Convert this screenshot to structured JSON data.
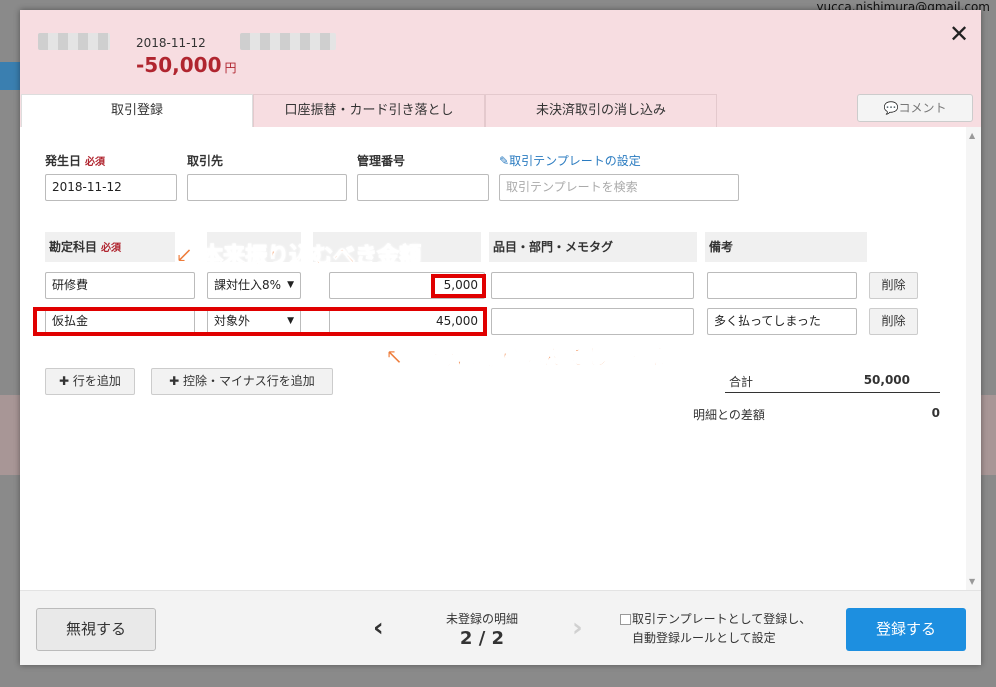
{
  "background": {
    "email": "yucca.nishimura@gmail.com"
  },
  "header": {
    "date": "2018-11-12",
    "amount": "-50,000",
    "amount_unit": "円",
    "close_icon": "close-icon"
  },
  "tabs": [
    {
      "label": "取引登録",
      "active": true
    },
    {
      "label": "口座振替・カード引き落とし",
      "active": false
    },
    {
      "label": "未決済取引の消し込み",
      "active": false
    }
  ],
  "comment_button": "💬コメント",
  "form": {
    "date_label": "発生日",
    "date_required": "必須",
    "date_value": "2018-11-12",
    "partner_label": "取引先",
    "partner_value": "",
    "ref_label": "管理番号",
    "ref_value": "",
    "template_link": "取引テンプレートの設定",
    "template_placeholder": "取引テンプレートを検索"
  },
  "table": {
    "headers": {
      "account": "勘定科目",
      "account_required": "必須",
      "item": "品目・部門・メモタグ",
      "note": "備考"
    },
    "rows": [
      {
        "account": "研修費",
        "tax": "課対仕入8%",
        "amount": "5,000",
        "item": "",
        "note": "",
        "delete": "削除"
      },
      {
        "account": "仮払金",
        "tax": "対象外",
        "amount": "45,000",
        "item": "",
        "note": "多く払ってしまった",
        "delete": "削除"
      }
    ]
  },
  "buttons": {
    "add_row": "行を追加",
    "add_minus_row": "控除・マイナス行を追加"
  },
  "totals": {
    "total_label": "合計",
    "total_value": "50,000",
    "diff_label": "明細との差額",
    "diff_value": "0"
  },
  "annotations": {
    "top": "↙ 本来振り込むべき金額",
    "bottom": "↖ 余分に振り込んでしまった金額"
  },
  "footer": {
    "ignore": "無視する",
    "unregistered_label": "未登録の明細",
    "page_counter": "2 / 2",
    "template_checkbox_line1": "取引テンプレートとして登録し、",
    "template_checkbox_line2": "自動登録ルールとして設定",
    "register": "登録する"
  },
  "colors": {
    "header_bg": "#f7dde1",
    "amount_red": "#b0252f",
    "register_blue": "#1d8fe0",
    "annotation_orange": "#ee7c3a",
    "highlight_red": "#e00000"
  }
}
